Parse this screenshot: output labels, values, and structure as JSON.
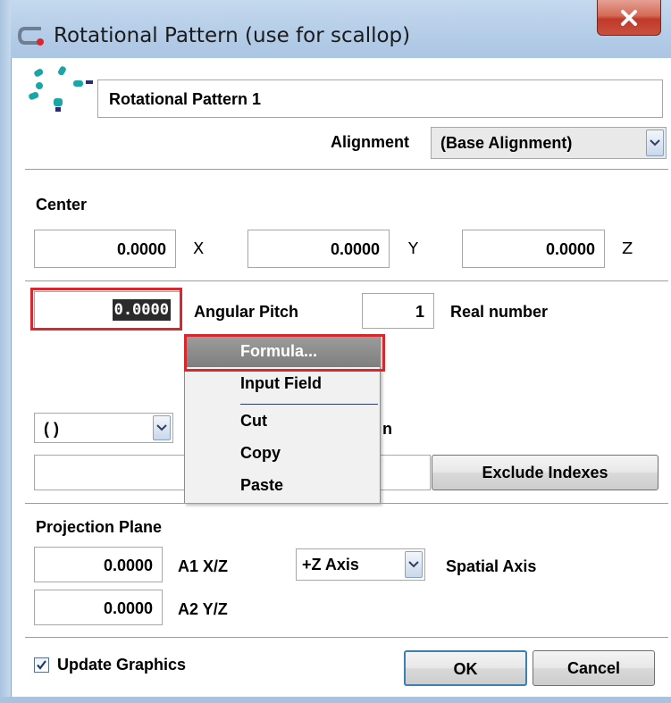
{
  "window": {
    "title": "Rotational Pattern (use for scallop)",
    "close_icon": "close-x-icon"
  },
  "header": {
    "name_value": "Rotational Pattern 1",
    "alignment_label": "Alignment",
    "alignment_value": "(Base Alignment)"
  },
  "center": {
    "title": "Center",
    "x_value": "0.0000",
    "x_label": "X",
    "y_value": "0.0000",
    "y_label": "Y",
    "z_value": "0.0000",
    "z_label": "Z"
  },
  "pitch": {
    "angular_value": "0.0000",
    "angular_label": "Angular Pitch",
    "count_value": "1",
    "count_label": "Real number"
  },
  "pattern": {
    "combo_value": "( )",
    "partial_label_tail": "n",
    "indexes_value": "",
    "exclude_button": "Exclude Indexes"
  },
  "context_menu": {
    "items": [
      "Formula...",
      "Input Field",
      "Cut",
      "Copy",
      "Paste"
    ],
    "selected": "Formula..."
  },
  "projection": {
    "title": "Projection Plane",
    "a1_value": "0.0000",
    "a1_label": "A1 X/Z",
    "a2_value": "0.0000",
    "a2_label": "A2 Y/Z",
    "axis_value": "+Z Axis",
    "axis_label": "Spatial Axis"
  },
  "footer": {
    "update_graphics_label": "Update Graphics",
    "update_graphics_checked": true,
    "ok_label": "OK",
    "cancel_label": "Cancel"
  },
  "colors": {
    "highlight": "#d9272e",
    "titlebar": "#b1cae6",
    "menu_selected": "#8a8a8a"
  }
}
